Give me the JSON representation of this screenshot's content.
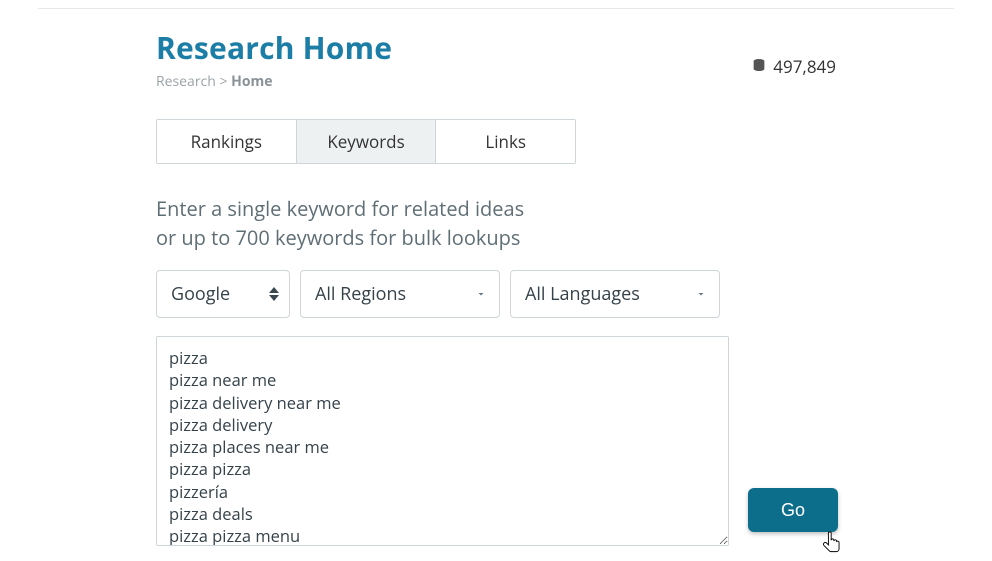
{
  "header": {
    "title": "Research Home",
    "breadcrumb": {
      "root": "Research",
      "sep": ">",
      "current": "Home"
    },
    "credits": "497,849"
  },
  "tabs": [
    {
      "label": "Rankings",
      "active": false
    },
    {
      "label": "Keywords",
      "active": true
    },
    {
      "label": "Links",
      "active": false
    }
  ],
  "instructions": {
    "line1": "Enter a single keyword for related ideas",
    "line2": "or up to 700 keywords for bulk lookups"
  },
  "selects": {
    "engine": "Google",
    "region": "All Regions",
    "language": "All Languages"
  },
  "textarea": {
    "value": "pizza\npizza near me\npizza delivery near me\npizza delivery\npizza places near me\npizza pizza\npizzería\npizza deals\npizza pizza menu\npizzeria"
  },
  "go": {
    "label": "Go"
  }
}
